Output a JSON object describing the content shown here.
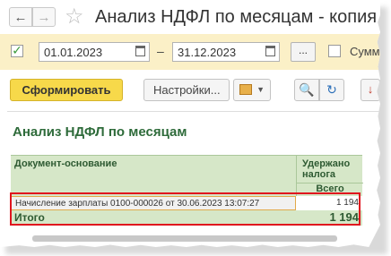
{
  "window": {
    "title": "Анализ НДФЛ по месяцам - копия"
  },
  "params": {
    "period_enabled": "✓",
    "date_from": "01.01.2023",
    "date_to": "31.12.2023",
    "date_separator": "–",
    "select_period_label": "...",
    "sum_label": "Сумм"
  },
  "toolbar": {
    "generate_label": "Сформировать",
    "settings_label": "Настройки...",
    "find_icon": "🔍",
    "find_next_icon": "↻"
  },
  "report": {
    "title": "Анализ НДФЛ по месяцам",
    "columns": {
      "document": "Документ-основание",
      "withheld": "Удержано налога",
      "withheld_sub": "Всего"
    },
    "rows": [
      {
        "document": "Начисление зарплаты 0100-000026 от 30.06.2023 13:07:27",
        "value": "1 194"
      }
    ],
    "total": {
      "label": "Итого",
      "value": "1 194"
    }
  },
  "colors": {
    "header_bg": "#d6e7c8",
    "params_bg": "#fbf0c7",
    "generate_btn": "#f7d94a",
    "highlight": "#e0141e"
  }
}
